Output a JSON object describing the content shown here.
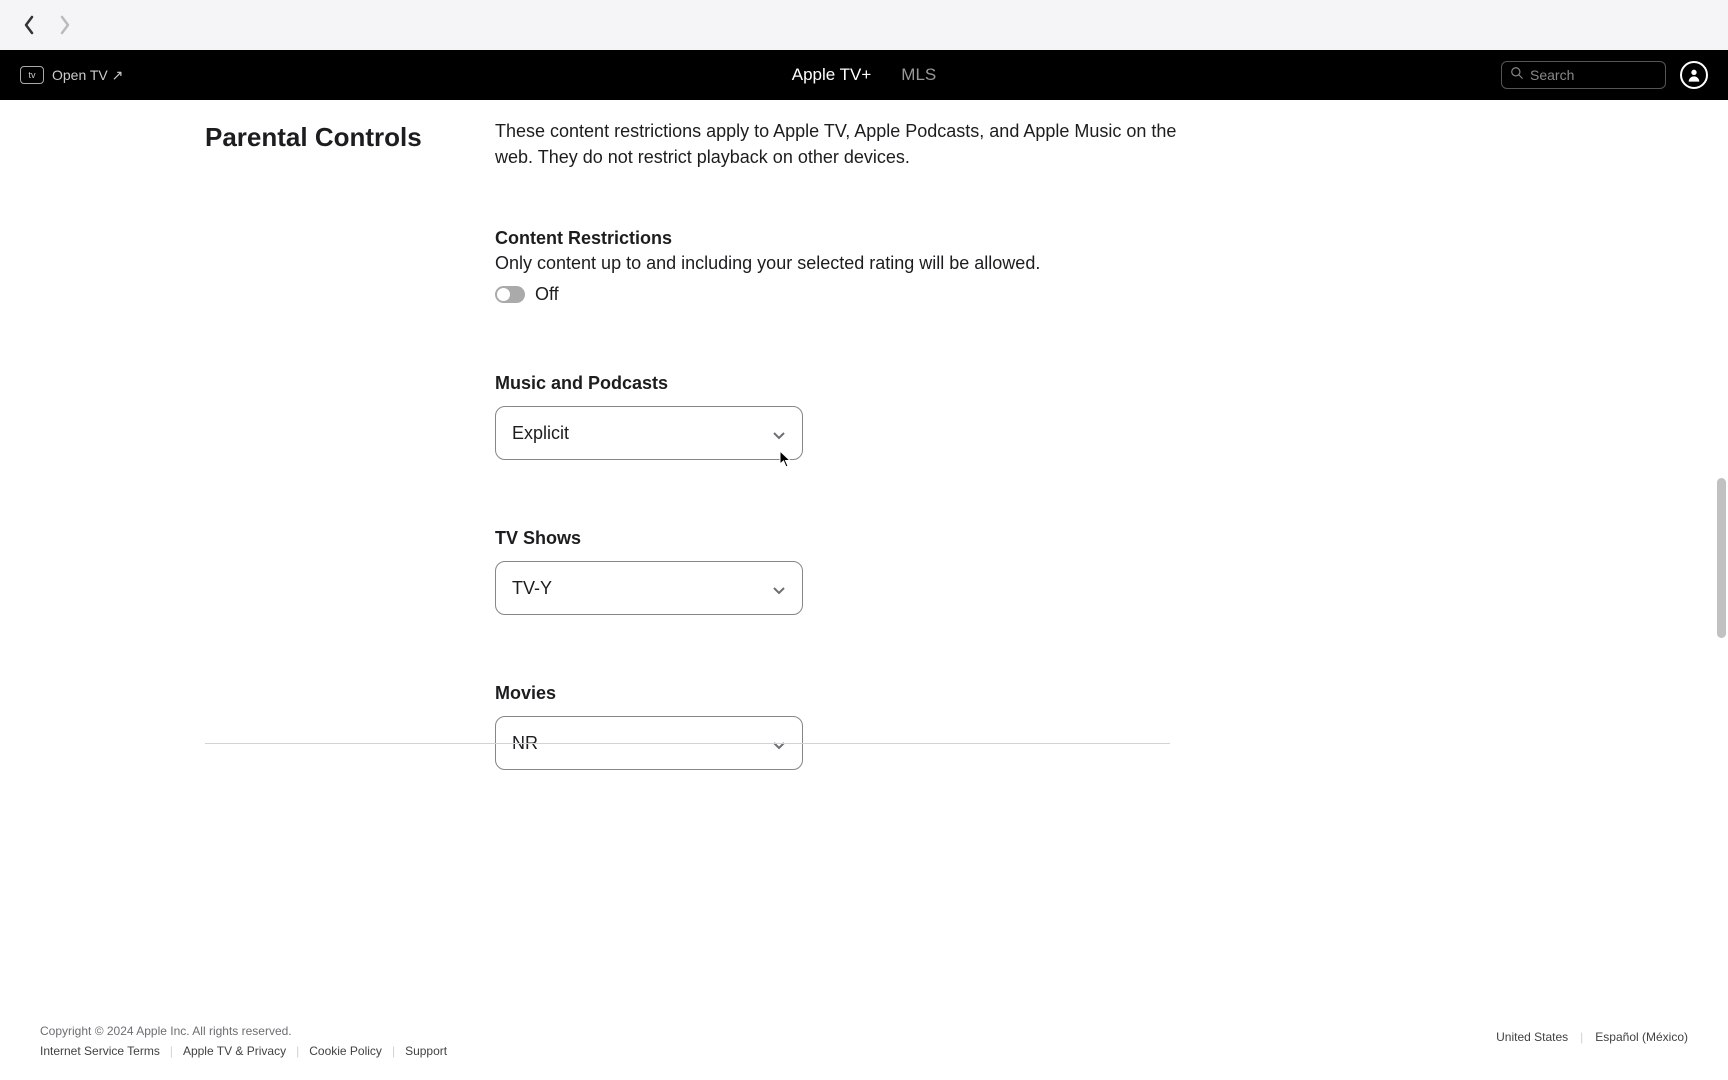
{
  "header": {
    "open_tv_label": "Open TV ↗",
    "open_tv_badge": "tv",
    "tabs": [
      {
        "label": "Apple TV+",
        "active": true
      },
      {
        "label": "MLS",
        "active": false
      }
    ],
    "search_placeholder": "Search"
  },
  "page": {
    "title": "Parental Controls",
    "intro": "These content restrictions apply to Apple TV, Apple Podcasts, and Apple Music on the web. They do not restrict playback on other devices."
  },
  "content_restrictions": {
    "title": "Content Restrictions",
    "description": "Only content up to and including your selected rating will be allowed.",
    "toggle_state": "Off"
  },
  "music_podcasts": {
    "title": "Music and Podcasts",
    "selected": "Explicit"
  },
  "tv_shows": {
    "title": "TV Shows",
    "selected": "TV-Y"
  },
  "movies": {
    "title": "Movies",
    "selected": "NR"
  },
  "footer": {
    "copyright": "Copyright © 2024 Apple Inc. All rights reserved.",
    "links": [
      "Internet Service Terms",
      "Apple TV & Privacy",
      "Cookie Policy",
      "Support"
    ],
    "region": "United States",
    "language": "Español (México)"
  }
}
